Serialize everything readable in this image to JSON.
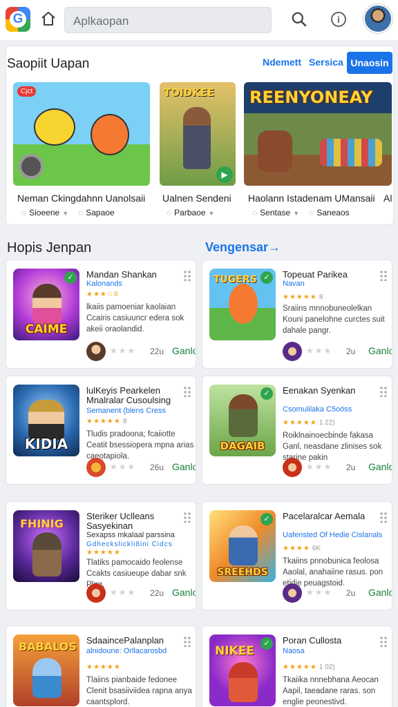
{
  "topbar": {
    "logo_letter": "G",
    "search_placeholder": "Aplkaopan"
  },
  "featured": {
    "title": "Saopiit Uapan",
    "tabs": [
      "Ndemett",
      "Sersica",
      "Unaosin"
    ],
    "cards": [
      {
        "image_label": "Cjct",
        "title": "Neman Ckingdahnn Uanolsaii",
        "meta1": "Sioeene",
        "meta2": "Sapaoe"
      },
      {
        "image_label": "TOIDKEE",
        "title": "Ualnen Sendeni",
        "meta1": "",
        "meta2": "Parbaoe"
      },
      {
        "image_label": "REENYONEAY",
        "title": "Haolann Istadenam UMansaii",
        "meta1": "Sentase",
        "meta2": "Saneaos"
      },
      {
        "image_label": "",
        "title": "Al",
        "meta1": "",
        "meta2": ""
      }
    ]
  },
  "section": {
    "title": "Hopis Jenpan",
    "link": "Vengensar→"
  },
  "apps": [
    {
      "name": "Mandan Shankan",
      "dev": "Kalonands",
      "rating": "★★★☆8",
      "rating_extra": "",
      "desc": "lkaiis pamoeniar kaolaian Ccairis casiuuncr edera sok akeii oraolandid.",
      "thumb_label": "CAIME",
      "size": "22u",
      "get": "Ganlo"
    },
    {
      "name": "Topeuat Parikea",
      "dev": "Navan",
      "rating": "★★★★★",
      "rating_extra": "8",
      "desc": "Sraiins mnnobuneolelkan Kouni panelohne curctes suit dahale pangr.",
      "thumb_label": "",
      "size": "2u",
      "get": "Ganlo"
    },
    {
      "name": "lulKeyis Pearkelen Mnalralar Cusoulsing",
      "dev": "Semanent (blens Cress",
      "rating": "★★★★★",
      "rating_extra": "8",
      "desc": "Tludis pradoona; fcaiiotte Ceatit bsessiopera mpna arias caeotapiola.",
      "thumb_label": "KIDIA",
      "size": "26u",
      "get": "Ganlo"
    },
    {
      "name": "Eenakan Syenkan",
      "dev": "Csomulilaka C5oöss",
      "rating": "★★★★★",
      "rating_extra": "1 22)",
      "desc": "Roiklnainoecbinde fakasa Ganl, neasdane zlinises sok starine pakin",
      "thumb_label": "DAGAIB",
      "size": "2u",
      "get": "Ganlo"
    },
    {
      "name": "Steriker Uclleans Sasyekinan",
      "dev": "Sexapss mkalaal parssina",
      "rating": "Gdheckslickli8ini Cidcs",
      "rating_extra": "",
      "desc": "Tlatiks pamocaido feolense Ccakts casiueupe dabar snk Plgg.",
      "thumb_label": "FHINIG",
      "size": "22u",
      "get": "Ganlo"
    },
    {
      "name": "Pacelaralcar Aemala",
      "dev": "Uafensted Of Hedie Cislanals",
      "rating": "★★★★",
      "rating_extra": "6K",
      "desc": "Tkaiins pnnobunica feolosa Aaolal, anahaiine rasus. pon etidie peuagstoid.",
      "thumb_label": "SREEHDS",
      "size": "2u",
      "get": "Ganlo"
    },
    {
      "name": "SdaaincePalanplan",
      "dev": "alnidoune: Orllacarosbd",
      "rating": "★★★★★",
      "rating_extra": "",
      "desc": "Tlaiins pianbaide fedonee Clenit bsasiiviidea rapna anya caantsplord.",
      "thumb_label": "BABALOS",
      "size": "",
      "get": ""
    },
    {
      "name": "Poran Cullosta",
      "dev": "Naosa",
      "rating": "★★★★★",
      "rating_extra": "1 02)",
      "desc": "Tkaiika nnnebhana Aeocan Aapil, taeadane raras. son englie peonestivd.",
      "thumb_label": "NIKEE",
      "size": "",
      "get": ""
    }
  ]
}
